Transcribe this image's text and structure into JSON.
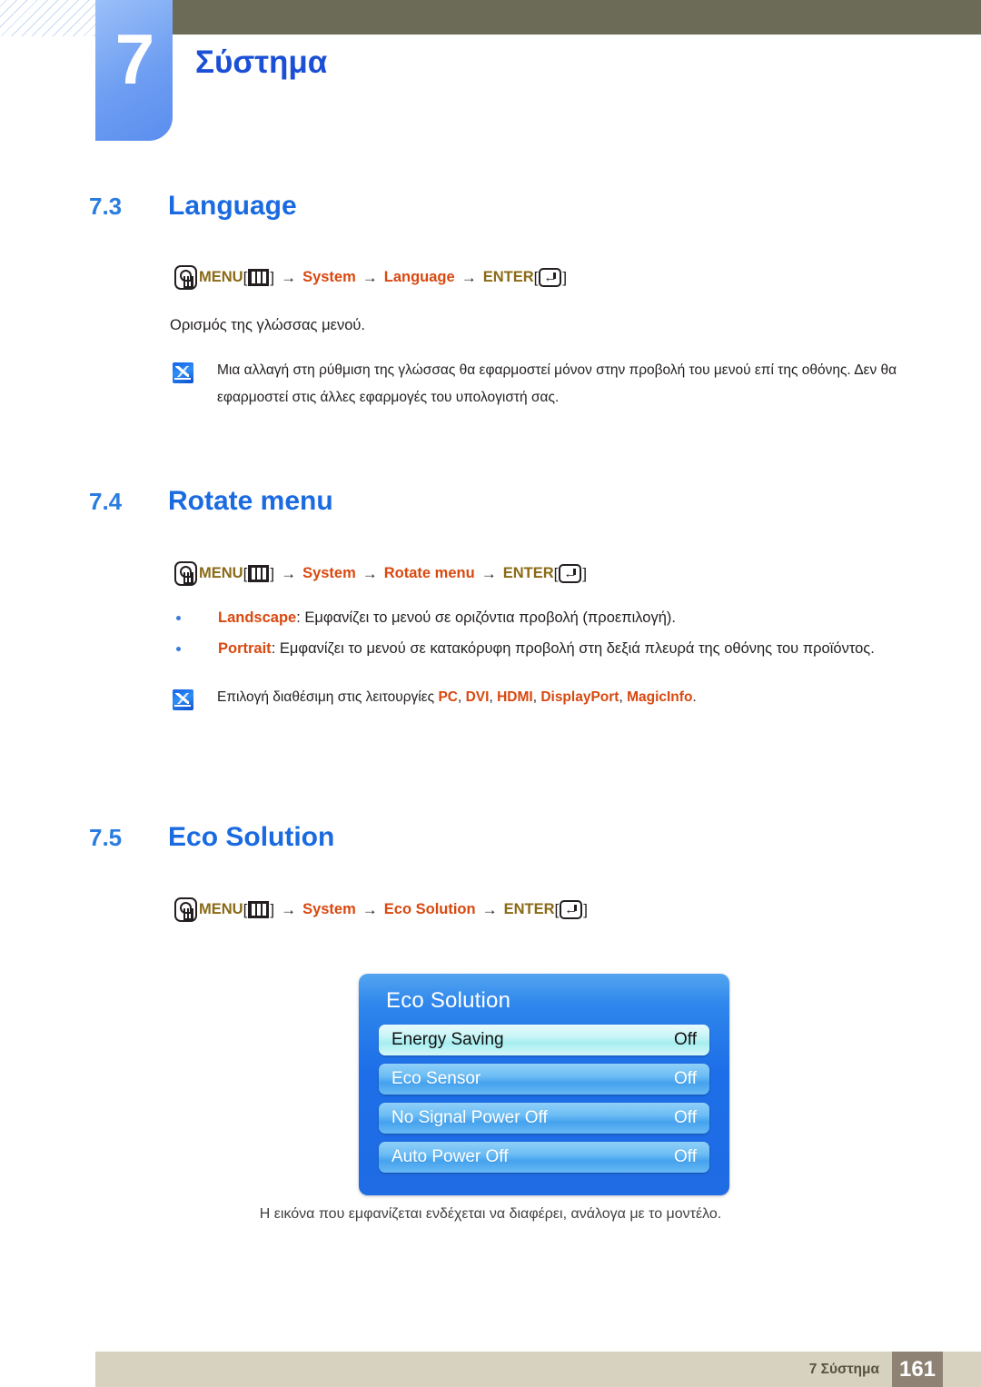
{
  "header": {
    "chapter_number": "7",
    "chapter_title": "Σύστημα"
  },
  "sections": [
    {
      "number": "7.3",
      "title": "Language",
      "menu_path": {
        "menu_label": "MENU",
        "menu_icon": "three-bars-icon",
        "step1": "System",
        "step2": "Language",
        "enter_label": "ENTER",
        "enter_icon": "enter-key-icon",
        "arrow": "→",
        "bracket_open": "[",
        "bracket_close": "]"
      },
      "paragraph": "Ορισμός της γλώσσας μενού.",
      "note": "Μια αλλαγή στη ρύθμιση της γλώσσας θα εφαρμοστεί μόνον στην προβολή του μενού επί της οθόνης. Δεν θα εφαρμοστεί στις άλλες εφαρμογές του υπολογιστή σας."
    },
    {
      "number": "7.4",
      "title": "Rotate menu",
      "menu_path": {
        "menu_label": "MENU",
        "step1": "System",
        "step2": "Rotate menu",
        "enter_label": "ENTER"
      },
      "bullets": [
        {
          "term": "Landscape",
          "text": ": Εμφανίζει το μενού σε οριζόντια προβολή (προεπιλογή)."
        },
        {
          "term": "Portrait",
          "text": ": Εμφανίζει το μενού σε κατακόρυφη προβολή στη δεξιά πλευρά της οθόνης του προϊόντος."
        }
      ],
      "note_prefix": "Επιλογή διαθέσιμη στις λειτουργίες ",
      "note_modes": [
        "PC",
        "DVI",
        "HDMI",
        "DisplayPort",
        "MagicInfo"
      ],
      "note_suffix": "."
    },
    {
      "number": "7.5",
      "title": "Eco Solution",
      "menu_path": {
        "menu_label": "MENU",
        "step1": "System",
        "step2": "Eco Solution",
        "enter_label": "ENTER"
      },
      "caption": "Η εικόνα που εμφανίζεται ενδέχεται να διαφέρει, ανάλογα με το μοντέλο."
    }
  ],
  "osd": {
    "title": "Eco Solution",
    "rows": [
      {
        "label": "Energy Saving",
        "value": "Off",
        "selected": true
      },
      {
        "label": "Eco Sensor",
        "value": "Off",
        "selected": false
      },
      {
        "label": "No Signal Power Off",
        "value": "Off",
        "selected": false
      },
      {
        "label": "Auto Power Off",
        "value": "Off",
        "selected": false
      }
    ]
  },
  "footer": {
    "label": "7 Σύστημα",
    "page": "161"
  },
  "colors": {
    "heading_blue": "#1a6ae0",
    "menu_gold": "#8a6a15",
    "menu_orange": "#d9480f",
    "topbar": "#6c6b58",
    "footer_bar": "#d7d2bf",
    "page_box": "#8e8274",
    "osd_blue": "#1d6ee8"
  }
}
